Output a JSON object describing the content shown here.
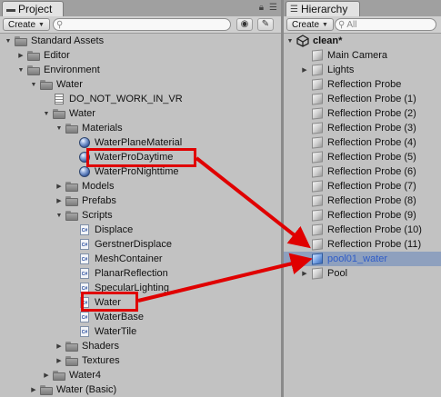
{
  "project_panel": {
    "tab_label": "Project",
    "create_label": "Create",
    "tree": [
      {
        "label": "Standard Assets",
        "indent": 1,
        "expanded": true,
        "icon": "folder-icon"
      },
      {
        "label": "Editor",
        "indent": 2,
        "expanded": false,
        "icon": "folder-icon"
      },
      {
        "label": "Environment",
        "indent": 2,
        "expanded": true,
        "icon": "folder-icon"
      },
      {
        "label": "Water",
        "indent": 3,
        "expanded": true,
        "icon": "folder-icon"
      },
      {
        "label": "DO_NOT_WORK_IN_VR",
        "indent": 4,
        "expanded": null,
        "icon": "document-icon"
      },
      {
        "label": "Water",
        "indent": 4,
        "expanded": true,
        "icon": "folder-icon"
      },
      {
        "label": "Materials",
        "indent": 5,
        "expanded": true,
        "icon": "folder-icon"
      },
      {
        "label": "WaterPlaneMaterial",
        "indent": 6,
        "expanded": null,
        "icon": "material-icon"
      },
      {
        "label": "WaterProDaytime",
        "indent": 6,
        "expanded": null,
        "icon": "material-icon"
      },
      {
        "label": "WaterProNighttime",
        "indent": 6,
        "expanded": null,
        "icon": "material-icon"
      },
      {
        "label": "Models",
        "indent": 5,
        "expanded": false,
        "icon": "folder-icon"
      },
      {
        "label": "Prefabs",
        "indent": 5,
        "expanded": false,
        "icon": "folder-icon"
      },
      {
        "label": "Scripts",
        "indent": 5,
        "expanded": true,
        "icon": "folder-icon"
      },
      {
        "label": "Displace",
        "indent": 6,
        "expanded": null,
        "icon": "script-icon"
      },
      {
        "label": "GerstnerDisplace",
        "indent": 6,
        "expanded": null,
        "icon": "script-icon"
      },
      {
        "label": "MeshContainer",
        "indent": 6,
        "expanded": null,
        "icon": "script-icon"
      },
      {
        "label": "PlanarReflection",
        "indent": 6,
        "expanded": null,
        "icon": "script-icon"
      },
      {
        "label": "SpecularLighting",
        "indent": 6,
        "expanded": null,
        "icon": "script-icon"
      },
      {
        "label": "Water",
        "indent": 6,
        "expanded": null,
        "icon": "script-icon"
      },
      {
        "label": "WaterBase",
        "indent": 6,
        "expanded": null,
        "icon": "script-icon"
      },
      {
        "label": "WaterTile",
        "indent": 6,
        "expanded": null,
        "icon": "script-icon"
      },
      {
        "label": "Shaders",
        "indent": 5,
        "expanded": false,
        "icon": "folder-icon"
      },
      {
        "label": "Textures",
        "indent": 5,
        "expanded": false,
        "icon": "folder-icon"
      },
      {
        "label": "Water4",
        "indent": 4,
        "expanded": false,
        "icon": "folder-icon"
      },
      {
        "label": "Water (Basic)",
        "indent": 3,
        "expanded": false,
        "icon": "folder-icon"
      }
    ]
  },
  "hierarchy_panel": {
    "tab_label": "Hierarchy",
    "create_label": "Create",
    "search_placeholder": "All",
    "scene_name": "clean*",
    "items": [
      {
        "label": "Main Camera",
        "expandable": false,
        "icon": "gameobject-icon",
        "selected": false
      },
      {
        "label": "Lights",
        "expandable": true,
        "icon": "gameobject-icon",
        "selected": false
      },
      {
        "label": "Reflection Probe",
        "expandable": false,
        "icon": "gameobject-icon",
        "selected": false
      },
      {
        "label": "Reflection Probe (1)",
        "expandable": false,
        "icon": "gameobject-icon",
        "selected": false
      },
      {
        "label": "Reflection Probe (2)",
        "expandable": false,
        "icon": "gameobject-icon",
        "selected": false
      },
      {
        "label": "Reflection Probe (3)",
        "expandable": false,
        "icon": "gameobject-icon",
        "selected": false
      },
      {
        "label": "Reflection Probe (4)",
        "expandable": false,
        "icon": "gameobject-icon",
        "selected": false
      },
      {
        "label": "Reflection Probe (5)",
        "expandable": false,
        "icon": "gameobject-icon",
        "selected": false
      },
      {
        "label": "Reflection Probe (6)",
        "expandable": false,
        "icon": "gameobject-icon",
        "selected": false
      },
      {
        "label": "Reflection Probe (7)",
        "expandable": false,
        "icon": "gameobject-icon",
        "selected": false
      },
      {
        "label": "Reflection Probe (8)",
        "expandable": false,
        "icon": "gameobject-icon",
        "selected": false
      },
      {
        "label": "Reflection Probe (9)",
        "expandable": false,
        "icon": "gameobject-icon",
        "selected": false
      },
      {
        "label": "Reflection Probe (10)",
        "expandable": false,
        "icon": "gameobject-icon",
        "selected": false
      },
      {
        "label": "Reflection Probe (11)",
        "expandable": false,
        "icon": "gameobject-icon",
        "selected": false
      },
      {
        "label": "pool01_water",
        "expandable": false,
        "icon": "prefab-icon",
        "selected": true
      },
      {
        "label": "Pool",
        "expandable": true,
        "icon": "gameobject-icon",
        "selected": false
      }
    ]
  },
  "annotation": {
    "highlight_color": "#e00000",
    "highlighted_items": [
      "WaterProDaytime",
      "Water"
    ],
    "arrow_target": "pool01_water"
  },
  "colors": {
    "panel_bg": "#c2c2c2",
    "selection_bg": "#8ea0be",
    "selection_text": "#2f5cc7"
  }
}
